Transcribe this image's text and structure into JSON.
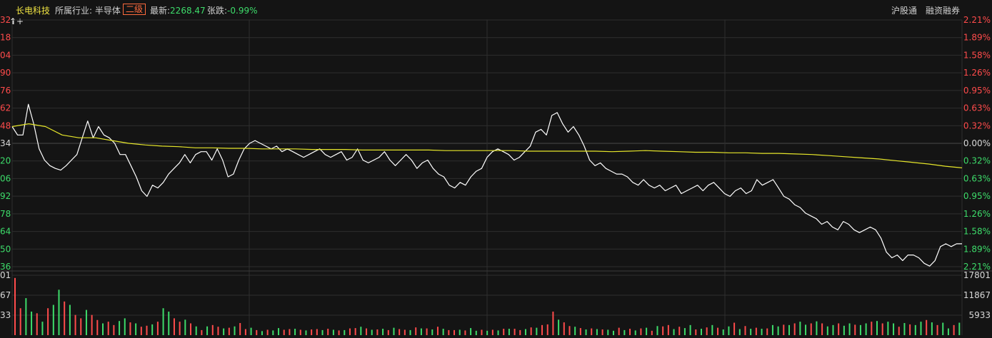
{
  "header": {
    "stock_name": "长电科技",
    "industry_label": "所属行业: 半导体",
    "industry_level": "二级",
    "latest_label": "最新:",
    "latest_value": "2268.47",
    "change_label": "张跌:",
    "change_value": "-0.99%",
    "tags": [
      "沪股通",
      "融资融券"
    ]
  },
  "colors": {
    "background": "#141414",
    "grid": "#2e2e2e",
    "price_line": "#ffffff",
    "avg_line": "#e6e62a",
    "up": "#ff4b4b",
    "down": "#3ddc6a",
    "neutral": "#d8d8d8"
  },
  "chart_data": {
    "type": "line",
    "price_axis": {
      "left_labels": [
        "32",
        "18",
        "04",
        "90",
        "76",
        "62",
        "48",
        "34",
        "20",
        "06",
        "92",
        "78",
        "64",
        "50",
        "36"
      ],
      "right_labels": [
        "2.21%",
        "1.89%",
        "1.58%",
        "1.26%",
        "0.95%",
        "0.63%",
        "0.32%",
        "0.00%",
        "0.32%",
        "0.63%",
        "0.95%",
        "1.26%",
        "1.58%",
        "1.89%",
        "2.21%"
      ],
      "label_colors": [
        "up",
        "up",
        "up",
        "up",
        "up",
        "up",
        "up",
        "neutral",
        "down",
        "down",
        "down",
        "down",
        "down",
        "down",
        "down"
      ],
      "pct_range": [
        -2.21,
        2.21
      ],
      "midline_pct": 0.0
    },
    "volume_axis": {
      "left_labels": [
        "01",
        "67",
        "33"
      ],
      "right_labels": [
        "17801",
        "11867",
        "5933"
      ],
      "range": [
        0,
        17801
      ]
    },
    "series": [
      {
        "values": [
          0.3,
          0.15,
          0.15,
          0.7,
          0.35,
          -0.1,
          -0.3,
          -0.4,
          -0.45,
          -0.48,
          -0.4,
          -0.3,
          -0.2,
          0.1,
          0.4,
          0.1,
          0.3,
          0.15,
          0.1,
          0.0,
          -0.2,
          -0.2,
          -0.4,
          -0.6,
          -0.85,
          -0.95,
          -0.75,
          -0.8,
          -0.7,
          -0.55,
          -0.45,
          -0.35,
          -0.2,
          -0.35,
          -0.2,
          -0.15,
          -0.15,
          -0.3,
          -0.1,
          -0.3,
          -0.6,
          -0.55,
          -0.3,
          -0.1,
          0.0,
          0.05,
          0.0,
          -0.05,
          -0.1,
          -0.05,
          -0.15,
          -0.1,
          -0.15,
          -0.2,
          -0.25,
          -0.2,
          -0.15,
          -0.1,
          -0.2,
          -0.25,
          -0.2,
          -0.15,
          -0.3,
          -0.25,
          -0.1,
          -0.3,
          -0.35,
          -0.3,
          -0.25,
          -0.15,
          -0.3,
          -0.4,
          -0.3,
          -0.2,
          -0.3,
          -0.45,
          -0.35,
          -0.3,
          -0.45,
          -0.55,
          -0.6,
          -0.75,
          -0.8,
          -0.7,
          -0.75,
          -0.6,
          -0.5,
          -0.45,
          -0.25,
          -0.15,
          -0.1,
          -0.15,
          -0.2,
          -0.3,
          -0.25,
          -0.15,
          -0.05,
          0.2,
          0.25,
          0.15,
          0.5,
          0.55,
          0.35,
          0.2,
          0.3,
          0.15,
          -0.05,
          -0.3,
          -0.4,
          -0.35,
          -0.45,
          -0.5,
          -0.55,
          -0.55,
          -0.6,
          -0.7,
          -0.75,
          -0.65,
          -0.75,
          -0.8,
          -0.75,
          -0.85,
          -0.8,
          -0.75,
          -0.9,
          -0.85,
          -0.8,
          -0.75,
          -0.85,
          -0.75,
          -0.7,
          -0.8,
          -0.9,
          -0.95,
          -0.85,
          -0.8,
          -0.9,
          -0.85,
          -0.65,
          -0.75,
          -0.7,
          -0.65,
          -0.8,
          -0.95,
          -1.0,
          -1.1,
          -1.15,
          -1.25,
          -1.3,
          -1.35,
          -1.45,
          -1.4,
          -1.5,
          -1.55,
          -1.4,
          -1.45,
          -1.55,
          -1.6,
          -1.55,
          -1.5,
          -1.55,
          -1.7,
          -1.95,
          -2.05,
          -2.0,
          -2.1,
          -2.0,
          -2.0,
          -2.05,
          -2.15,
          -2.2,
          -2.1,
          -1.85,
          -1.8,
          -1.85,
          -1.8,
          -1.8
        ]
      },
      {
        "values": [
          0.3,
          0.35,
          0.3,
          0.15,
          0.1,
          0.1,
          0.05,
          0.0,
          -0.03,
          -0.05,
          -0.06,
          -0.08,
          -0.08,
          -0.09,
          -0.09,
          -0.1,
          -0.1,
          -0.1,
          -0.11,
          -0.11,
          -0.11,
          -0.12,
          -0.12,
          -0.12,
          -0.12,
          -0.12,
          -0.13,
          -0.13,
          -0.13,
          -0.13,
          -0.13,
          -0.14,
          -0.14,
          -0.14,
          -0.14,
          -0.14,
          -0.15,
          -0.14,
          -0.13,
          -0.14,
          -0.15,
          -0.16,
          -0.16,
          -0.17,
          -0.17,
          -0.18,
          -0.18,
          -0.19,
          -0.2,
          -0.22,
          -0.24,
          -0.26,
          -0.28,
          -0.31,
          -0.34,
          -0.37,
          -0.41,
          -0.44
        ]
      }
    ],
    "volumes": [
      17000,
      8000,
      11000,
      7000,
      6500,
      4000,
      8000,
      9000,
      13500,
      10000,
      9000,
      6000,
      5000,
      7500,
      6000,
      4500,
      3500,
      4000,
      3000,
      4200,
      5000,
      3800,
      3500,
      2500,
      2800,
      3200,
      4000,
      8000,
      7000,
      5000,
      4000,
      4600,
      3500,
      2600,
      1500,
      2600,
      3000,
      2500,
      2000,
      2200,
      2600,
      3600,
      1800,
      2200,
      1500,
      1200,
      1600,
      1400,
      2100,
      1600,
      1800,
      1900,
      1600,
      1400,
      1700,
      1800,
      1500,
      1900,
      1600,
      1400,
      1500,
      2000,
      2100,
      2500,
      2000,
      1600,
      1700,
      1900,
      1500,
      2200,
      1800,
      1600,
      1500,
      2300,
      2000,
      2000,
      1700,
      2500,
      1900,
      1500,
      1500,
      1600,
      1400,
      2100,
      1300,
      1600,
      1300,
      1600,
      1400,
      1900,
      1900,
      1900,
      1500,
      1800,
      2300,
      2200,
      3000,
      3200,
      7000,
      4600,
      3800,
      2700,
      2500,
      2100,
      1700,
      2000,
      1800,
      1700,
      1600,
      1300,
      2200,
      1500,
      1900,
      1400,
      2000,
      2200,
      1300,
      2700,
      2600,
      3000,
      1800,
      2500,
      2100,
      3000,
      1700,
      1900,
      2300,
      3000,
      2200,
      1700,
      2600,
      3700,
      1800,
      2700,
      1900,
      2200,
      1900,
      2000,
      3000,
      2600,
      3100,
      3000,
      3500,
      4000,
      3100,
      3500,
      4100,
      3500,
      2600,
      3000,
      3500,
      2800,
      3500,
      3100,
      3000,
      3500,
      4000,
      4200,
      3500,
      4000,
      3500,
      2500,
      3600,
      3200,
      3000,
      4000,
      4500,
      3800,
      3000,
      3700,
      2000,
      3000,
      3700
    ]
  },
  "chart_volume_colors": [
    1,
    1,
    0,
    0,
    1,
    0,
    1,
    0,
    0,
    1,
    0,
    1,
    1,
    0,
    1,
    1,
    0,
    1,
    1,
    0,
    0,
    1,
    0,
    1,
    1,
    0,
    1,
    0,
    0,
    1,
    1,
    0,
    1,
    0,
    1,
    0,
    1,
    1,
    0,
    1,
    0,
    1,
    1,
    0,
    1,
    0,
    1,
    0,
    0,
    1,
    1,
    0,
    1,
    0,
    1,
    1,
    0,
    1,
    0,
    1,
    0,
    1,
    1,
    0,
    1,
    0,
    1,
    0,
    1,
    0,
    1,
    1,
    0,
    1,
    0,
    1,
    0,
    1,
    0,
    1,
    1,
    0,
    1,
    0,
    0,
    1,
    0,
    1,
    0,
    1,
    0,
    1,
    1,
    0,
    1,
    0,
    1,
    1,
    1,
    0,
    1,
    1,
    0,
    1,
    0,
    1,
    0,
    1,
    0,
    0,
    1,
    0,
    1,
    0,
    1,
    0,
    1,
    0,
    1,
    1,
    0,
    1,
    0,
    0,
    1,
    0,
    1,
    0,
    1,
    0,
    0,
    1,
    0,
    1,
    0,
    1,
    0,
    1,
    0,
    0,
    1,
    0,
    1,
    0,
    0,
    1,
    0,
    1,
    0,
    0,
    1,
    0,
    0,
    1,
    0,
    0,
    1,
    0,
    1,
    0,
    0,
    1,
    0,
    1,
    0,
    0,
    1,
    0,
    1,
    0,
    0,
    1,
    0,
    1
  ]
}
